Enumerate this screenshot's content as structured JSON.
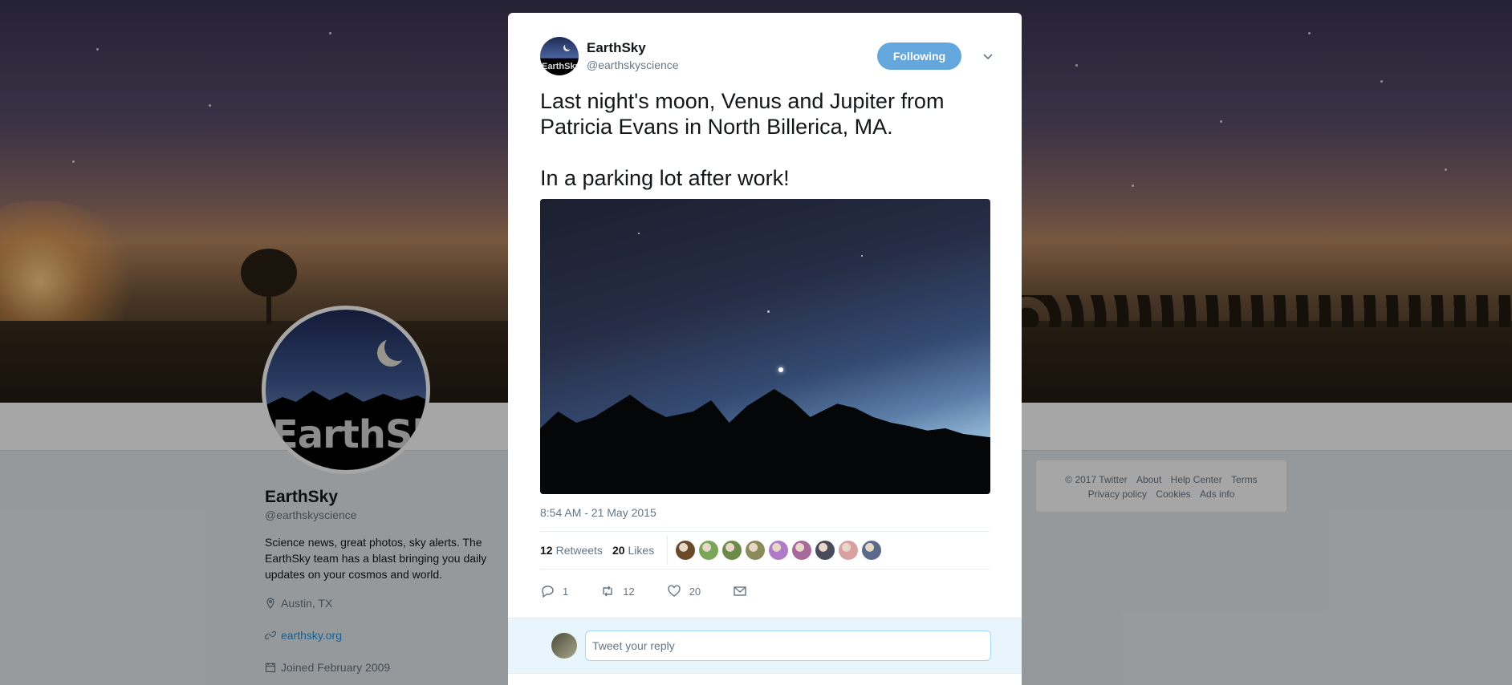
{
  "profile": {
    "name": "EarthSky",
    "handle": "@earthskyscience",
    "avatar_wordmark": "EarthSky",
    "bio": "Science news, great photos, sky alerts. The EarthSky team has a blast bringing you daily updates on your cosmos and world.",
    "location": "Austin, TX",
    "website": "earthsky.org",
    "joined": "Joined February 2009"
  },
  "footer": {
    "copyright": "© 2017 Twitter",
    "about": "About",
    "help": "Help Center",
    "terms": "Terms",
    "privacy": "Privacy policy",
    "cookies": "Cookies",
    "ads": "Ads info"
  },
  "tweet": {
    "author_name": "EarthSky",
    "author_handle": "@earthskyscience",
    "avatar_wordmark": "EarthSky",
    "follow_label": "Following",
    "text": "Last night's moon, Venus and Jupiter from Patricia Evans in North Billerica, MA.\n\nIn a parking lot after work!",
    "timestamp": "8:54 AM - 21 May 2015",
    "retweets_count": "12",
    "retweets_label": "Retweets",
    "likes_count": "20",
    "likes_label": "Likes",
    "liker_avatar_colors": [
      "#6b4a2a",
      "#7aa65a",
      "#6c8a4a",
      "#8a8a5a",
      "#b07ac8",
      "#a86a9a",
      "#4a4a5a",
      "#d8a0a0",
      "#5a6a8a"
    ],
    "actions": {
      "reply_count": "1",
      "retweet_count": "12",
      "like_count": "20"
    }
  },
  "reply": {
    "placeholder": "Tweet your reply"
  },
  "colors": {
    "accent": "#1b95e0",
    "follow_button": "#63a7dd"
  },
  "icons": [
    "location-icon",
    "link-icon",
    "calendar-icon",
    "chevron-down-icon",
    "reply-icon",
    "retweet-icon",
    "like-icon",
    "message-icon"
  ]
}
